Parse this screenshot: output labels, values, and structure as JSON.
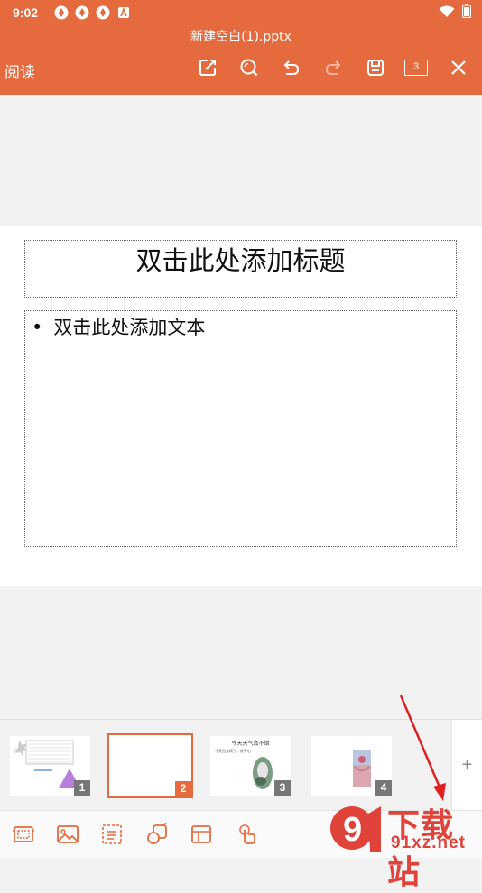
{
  "status_bar": {
    "time": "9:02"
  },
  "header": {
    "file_name": "新建空白(1).pptx",
    "mode_label": "阅读",
    "slide_count": "3"
  },
  "toolbar": {
    "icons": [
      "edit-icon",
      "search-icon",
      "undo-icon",
      "redo-icon",
      "save-icon",
      "slide-count-box",
      "close-icon"
    ]
  },
  "slide": {
    "title_placeholder": "双击此处添加标题",
    "body_placeholder": "双击此处添加文本",
    "bullet": "•"
  },
  "thumbnails": [
    {
      "number": "1"
    },
    {
      "number": "2",
      "active": true
    },
    {
      "number": "3",
      "title": "今天天气真不错",
      "text": "今天出去玩了，好开心"
    },
    {
      "number": "4"
    }
  ],
  "add_slide_label": "+",
  "bottom_toolbar": {
    "icons": [
      "insert-slide-icon",
      "image-icon",
      "textbox-icon",
      "shape-icon",
      "table-icon",
      "pointer-icon"
    ]
  },
  "watermark": {
    "brand": "下载站",
    "url": "91xz.net",
    "logo": "9"
  },
  "colors": {
    "accent": "#e56b3f",
    "watermark": "#e0433a"
  }
}
